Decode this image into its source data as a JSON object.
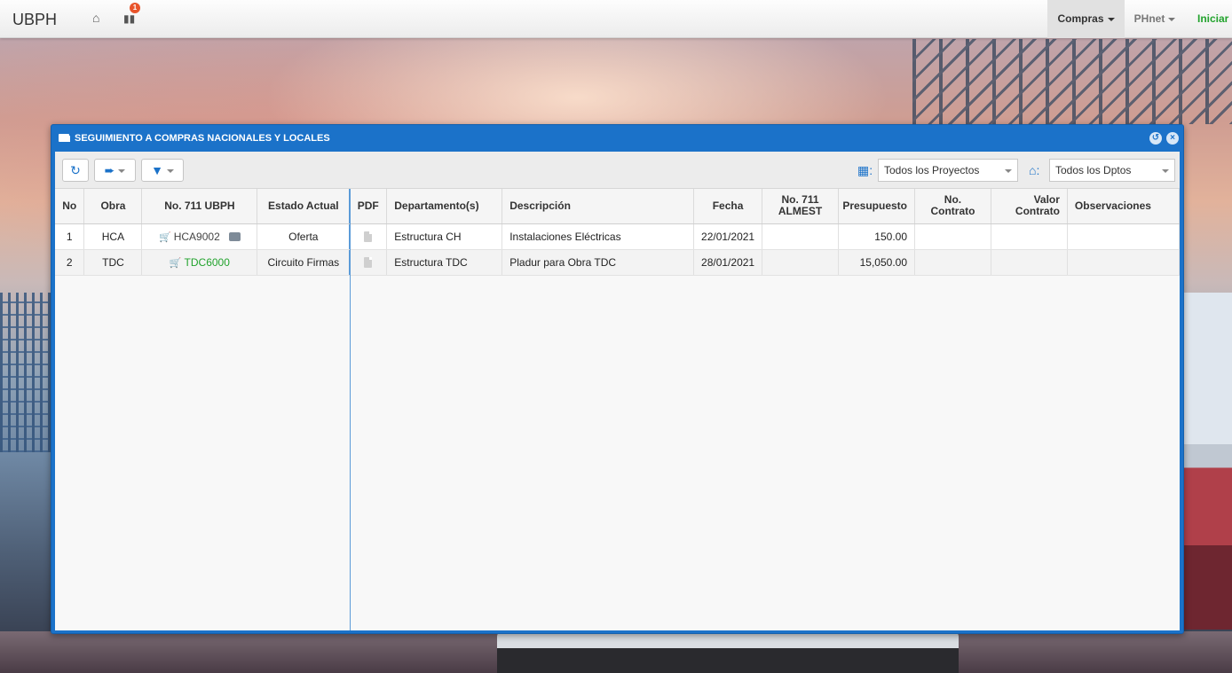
{
  "navbar": {
    "brand": "UBPH",
    "home_icon": "home-icon",
    "chart_icon": "bar-chart-icon",
    "badge_count": "1",
    "menu": [
      {
        "label": "Compras",
        "active": true
      },
      {
        "label": "PHnet",
        "active": false
      },
      {
        "label": "Iniciar",
        "active": false
      }
    ],
    "colors": {
      "active_bg": "#e1e1e1",
      "iniciar": "#22a32d"
    }
  },
  "window": {
    "title": "SEGUIMIENTO A COMPRAS NACIONALES Y LOCALES",
    "title_icon": "truck-icon",
    "accent": "#1b72c9",
    "toolbar": {
      "refresh_icon": "refresh-icon",
      "export_icon": "export-icon",
      "filter_icon": "filter-icon",
      "project_icon": "building-icon",
      "project_select": "Todos los Proyectos",
      "dept_icon": "home-icon",
      "dept_select": "Todos los Dptos"
    },
    "table": {
      "headers": {
        "no": "No",
        "obra": "Obra",
        "ubph": "No. 711 UBPH",
        "estado": "Estado Actual",
        "pdf": "PDF",
        "dept": "Departamento(s)",
        "desc": "Descripción",
        "fecha": "Fecha",
        "almest_1": "No. 711",
        "almest_2": "ALMEST",
        "presupuesto": "Presupuesto",
        "contrato_1": "No.",
        "contrato_2": "Contrato",
        "valor_1": "Valor",
        "valor_2": "Contrato",
        "obs": "Observaciones"
      },
      "rows": [
        {
          "no": "1",
          "obra": "HCA",
          "ubph": "HCA9002",
          "estado": "Oferta",
          "dept": "Estructura CH",
          "desc": "Instalaciones Eléctricas",
          "fecha": "22/01/2021",
          "almest": "",
          "presupuesto": "150.00",
          "contrato": "",
          "valor": "",
          "obs": ""
        },
        {
          "no": "2",
          "obra": "TDC",
          "ubph": "TDC6000",
          "estado": "Circuito Firmas",
          "dept": "Estructura TDC",
          "desc": "Pladur para Obra TDC",
          "fecha": "28/01/2021",
          "almest": "",
          "presupuesto": "15,050.00",
          "contrato": "",
          "valor": "",
          "obs": ""
        }
      ]
    }
  }
}
